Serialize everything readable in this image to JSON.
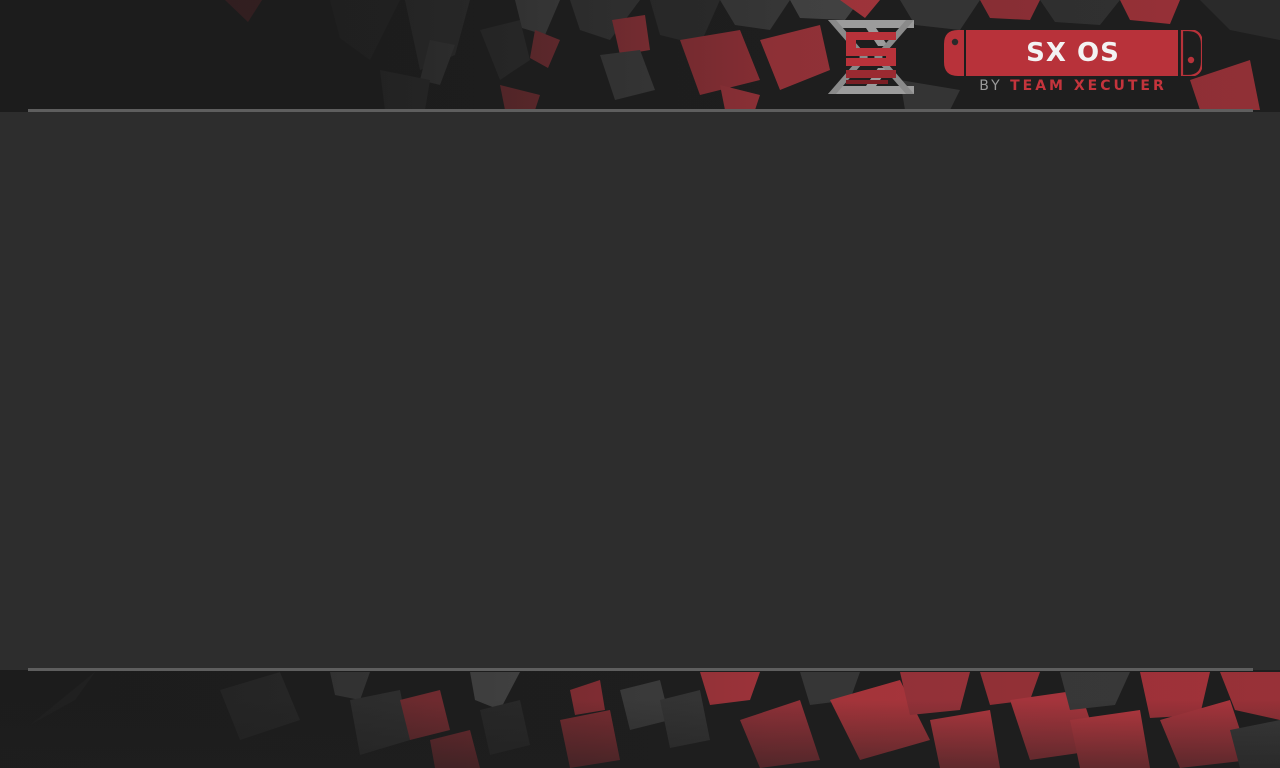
{
  "logo": {
    "title": "SX OS",
    "subtitle_by": "BY ",
    "subtitle_team": "TEAM XECUTER",
    "emblem_icon": "sx-emblem-icon",
    "badge_icon": "switch-console-badge-icon"
  },
  "theme": {
    "accent": "#b8323a",
    "accent_dark": "#7a1e24",
    "panel": "#2d2d2d",
    "background": "#1d1d1d",
    "divider": "#5e5e5e",
    "logo_silver": "#9c9c9c"
  },
  "content": {
    "items": []
  }
}
